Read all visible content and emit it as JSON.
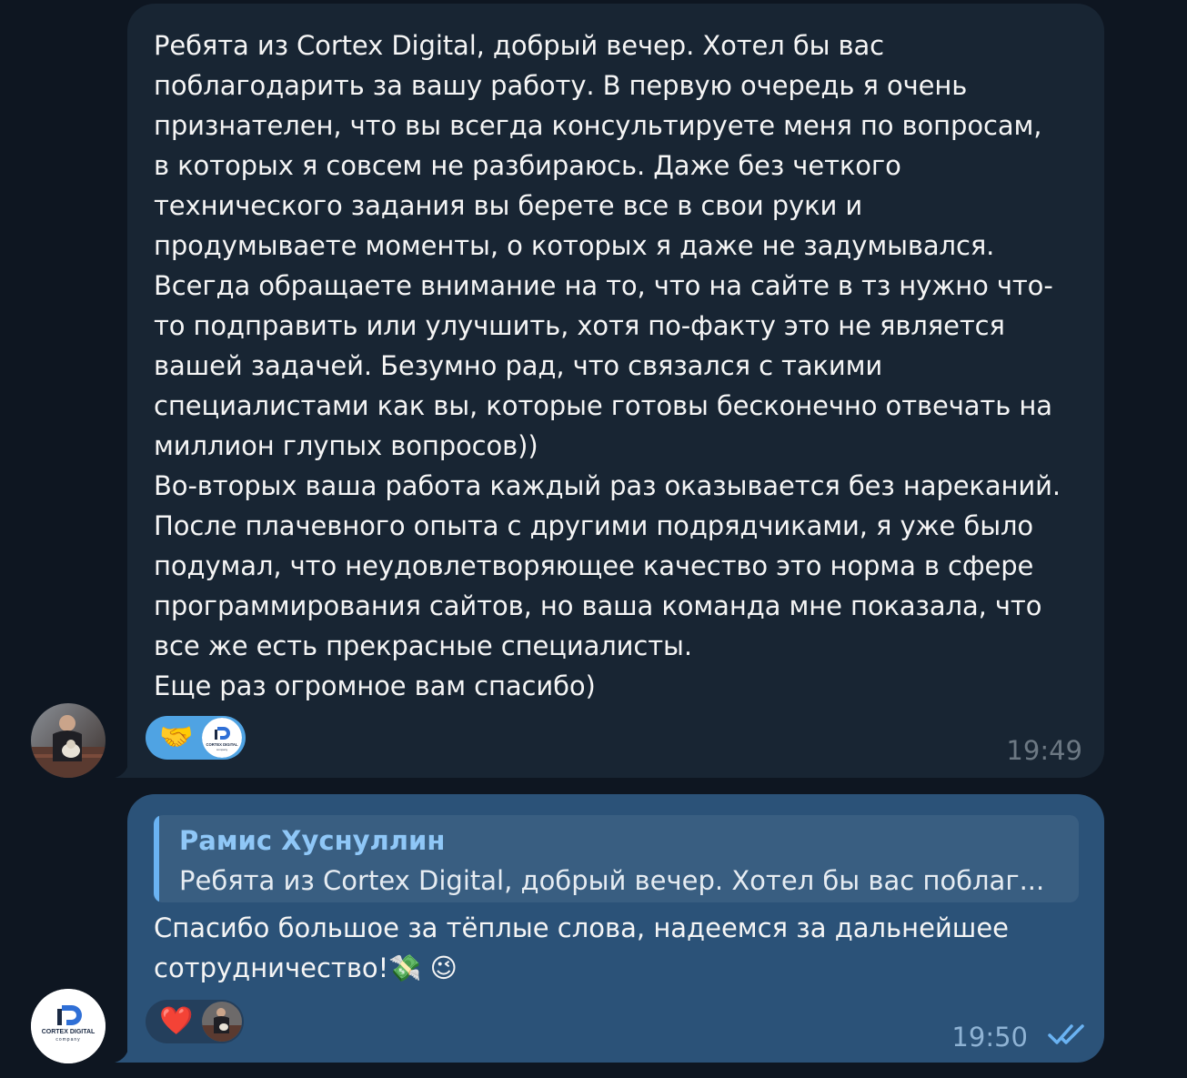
{
  "messages": [
    {
      "direction": "incoming",
      "text": "Ребята из Cortex Digital, добрый вечер. Хотел бы вас\nпоблагодарить за вашу работу. В первую очередь я очень\nпризнателен, что вы всегда консультируете меня по вопросам,\nв которых я совсем не разбираюсь. Даже без четкого\nтехнического задания вы берете все в свои руки и\nпродумываете моменты, о которых я даже не задумывался.\nВсегда обращаете внимание на то, что на сайте в тз нужно что-\nто подправить или улучшить, хотя по-факту это не является\nвашей задачей. Безумно рад, что связался с такими\nспециалистами как вы, которые готовы бесконечно отвечать на\nмиллион глупых вопросов))\nВо-вторых ваша работа каждый раз оказывается без нареканий.\nПосле плачевного опыта с другими подрядчиками, я уже было\nподумал, что неудовлетворяющее качество это норма в сфере\nпрограммирования сайтов, но ваша команда мне показала, что\nвсе же есть прекрасные специалисты.\nЕще раз огромное вам спасибо)",
      "reaction_emoji": "🤝",
      "reaction_icon": "handshake-icon",
      "time": "19:49"
    },
    {
      "direction": "outgoing",
      "reply_to": {
        "name": "Рамис Хуснуллин",
        "text": "Ребята из Cortex Digital, добрый вечер. Хотел бы вас поблаг..."
      },
      "text": "Спасибо большое за тёплые слова, надеемся за дальнейшее\nсотрудничество!💸 😉",
      "reaction_emoji": "❤️",
      "reaction_icon": "heart-icon",
      "time": "19:50",
      "status_icon": "double-check-icon"
    }
  ],
  "company_logo": {
    "name": "CORTEX DIGITAL",
    "tagline": "company"
  },
  "colors": {
    "background": "#0e1621",
    "incoming_bubble": "#182533",
    "outgoing_bubble": "#2b5278",
    "accent": "#6ab3f3"
  }
}
